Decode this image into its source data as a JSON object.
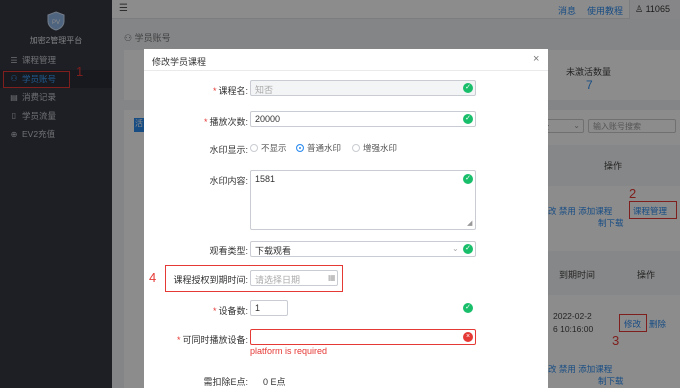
{
  "sidebar": {
    "app_name": "加密2管理平台",
    "items": [
      {
        "label": "课程管理",
        "icon": "list-icon"
      },
      {
        "label": "学员账号",
        "icon": "user-group-icon",
        "active": true
      },
      {
        "label": "消费记录",
        "icon": "receipt-icon"
      },
      {
        "label": "学员流量",
        "icon": "file-icon"
      },
      {
        "label": "EV2充值",
        "icon": "plus-circle-icon"
      }
    ]
  },
  "topbar": {
    "menu_icon": "☰",
    "messages": "消息",
    "tutorial": "使用教程",
    "user": "11065"
  },
  "page": {
    "breadcrumb": "学员账号",
    "stat_label": "未激活数量",
    "stat_value": "7",
    "tag_text": "活",
    "select_text": "全",
    "search_placeholder": "输入账号搜索",
    "th_op_1": "操作",
    "row1_ops_line1": "改 禁用  添加课程",
    "row1_ops_line2": "制下载",
    "btn_course": "课程管理",
    "th_due": "到期时间",
    "th_op_2": "操作",
    "row2_date_1": "2022-02-2",
    "row2_date_2": "6 10:16:00",
    "btn_edit": "修改",
    "btn_delete": "删除",
    "row3_ops_line1": "改 禁用  添加课程",
    "row3_ops_line2": "制下载"
  },
  "annotations": {
    "a1": "1",
    "a2": "2",
    "a3": "3",
    "a4": "4"
  },
  "modal": {
    "title": "修改学员课程",
    "close": "×",
    "fields": {
      "course_label": "课程名:",
      "course_value": "知否",
      "plays_label": "播放次数:",
      "plays_value": "20000",
      "watermark_label": "水印显示:",
      "watermark_options": [
        "不显示",
        "普通水印",
        "增强水印"
      ],
      "watermark_selected": "普通水印",
      "wm_content_label": "水印内容:",
      "wm_content_value": "1581",
      "watch_type_label": "观看类型:",
      "watch_type_value": "下载观看",
      "expire_label": "课程授权到期时间:",
      "expire_placeholder": "请选择日期",
      "devices_label": "设备数:",
      "devices_value": "1",
      "concurrent_label": "可同时播放设备:",
      "concurrent_value": "",
      "concurrent_error": "platform is required",
      "deduct_label": "需扣除E点:",
      "deduct_value": "0 E点"
    }
  }
}
